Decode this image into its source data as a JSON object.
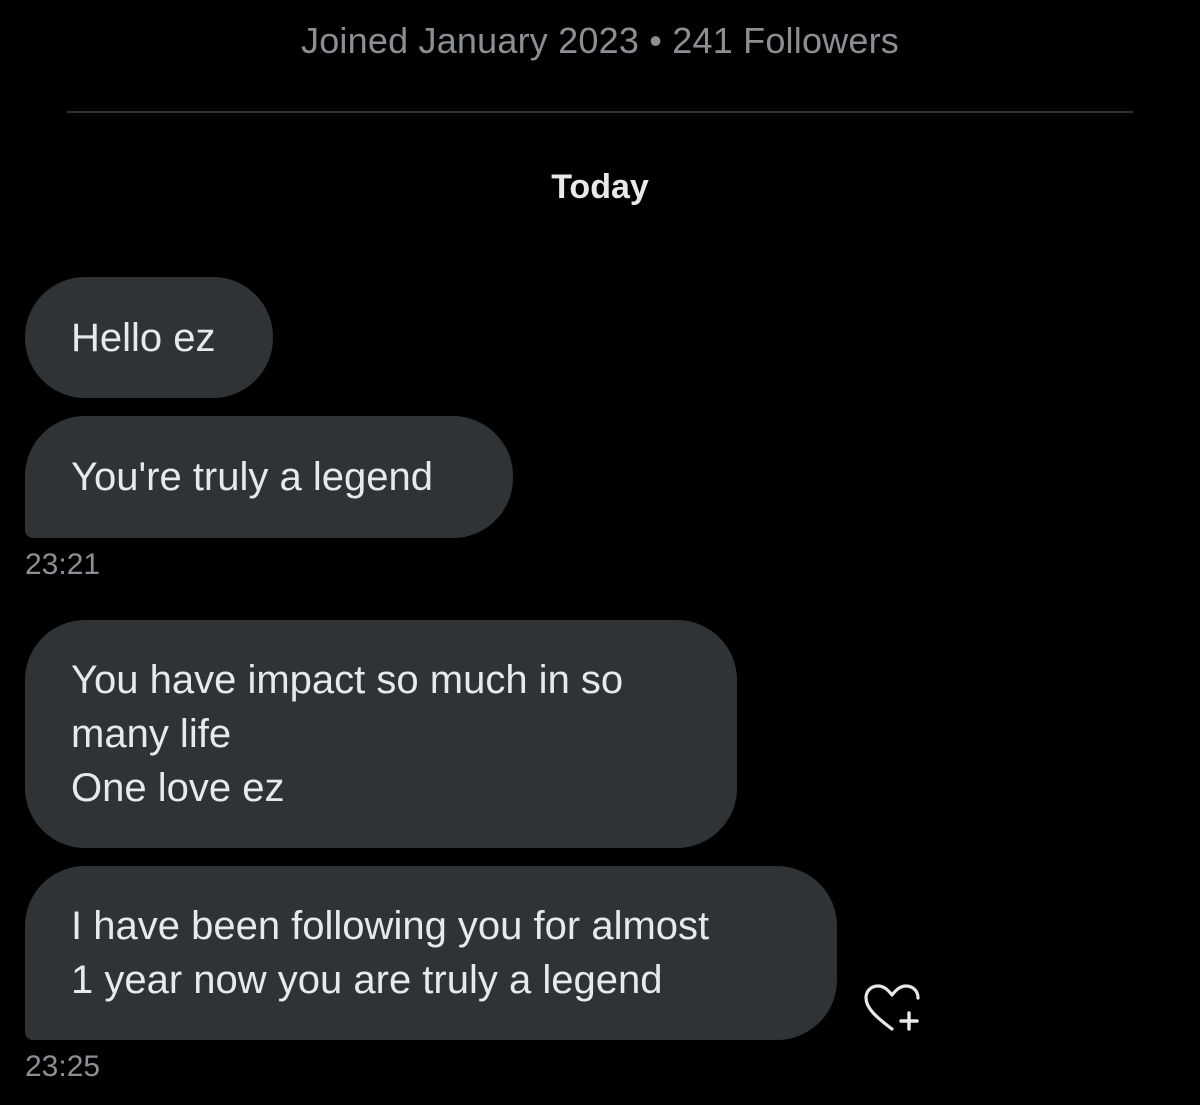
{
  "profile": {
    "meta": "Joined January 2023 • 241 Followers"
  },
  "conversation": {
    "day_label": "Today",
    "messages": [
      {
        "lines": [
          "Hello ez"
        ]
      },
      {
        "lines": [
          "You're truly a legend"
        ],
        "timestamp": "23:21"
      },
      {
        "lines": [
          "You have impact so much in so",
          "many life",
          "One love ez"
        ]
      },
      {
        "lines": [
          "I have been following you for almost",
          "1 year now you are truly a legend"
        ],
        "timestamp": "23:25"
      }
    ]
  },
  "icons": {
    "react": "heart-plus-icon"
  },
  "colors": {
    "background": "#000000",
    "bubble": "#2f3336",
    "text": "#e7e9ea",
    "muted": "#8b8f94"
  }
}
